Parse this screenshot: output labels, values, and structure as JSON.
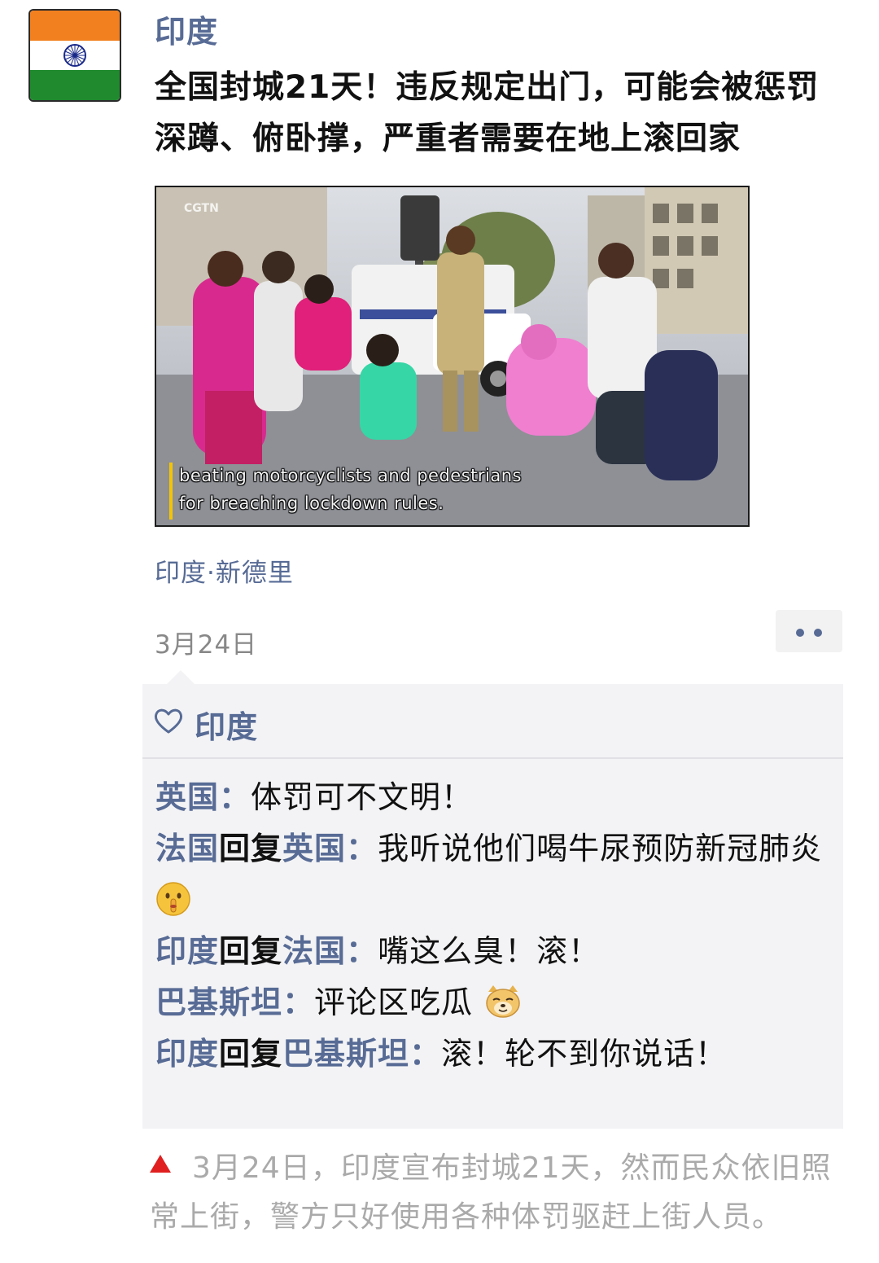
{
  "post": {
    "author": "印度",
    "headline": "全国封城21天！违反规定出门，可能会被惩罚深蹲、俯卧撑，严重者需要在地上滚回家",
    "image": {
      "logo": "CGTN",
      "subtitle_line1": "beating motorcyclists and pedestrians",
      "subtitle_line2": "for breaching lockdown rules."
    },
    "location": "印度·新德里",
    "date": "3月24日",
    "more_icon": "more-dots-icon"
  },
  "likes": {
    "icon": "heart-icon",
    "names": "印度"
  },
  "comments": [
    {
      "from": "英国",
      "reply_word": "",
      "to": "",
      "colon": "：",
      "text": "体罚可不文明！",
      "emoji": ""
    },
    {
      "from": "法国",
      "reply_word": "回复",
      "to": "英国",
      "colon": "：",
      "text": "我听说他们喝牛尿预防新冠肺炎",
      "emoji": "shush-emoji"
    },
    {
      "from": "印度",
      "reply_word": "回复",
      "to": "法国",
      "colon": "：",
      "text": "嘴这么臭！滚！",
      "emoji": ""
    },
    {
      "from": "巴基斯坦",
      "reply_word": "",
      "to": "",
      "colon": "：",
      "text": "评论区吃瓜",
      "emoji": "doge-emoji"
    },
    {
      "from": "印度",
      "reply_word": "回复",
      "to": "巴基斯坦",
      "colon": "：",
      "text": "滚！轮不到你说话！",
      "emoji": ""
    }
  ],
  "caption": {
    "text": "3月24日，印度宣布封城21天，然而民众依旧照常上街，警方只好使用各种体罚驱赶上街人员。",
    "marker_color": "#e02020"
  },
  "colors": {
    "link": "#576b95",
    "panel": "#f3f3f5"
  }
}
